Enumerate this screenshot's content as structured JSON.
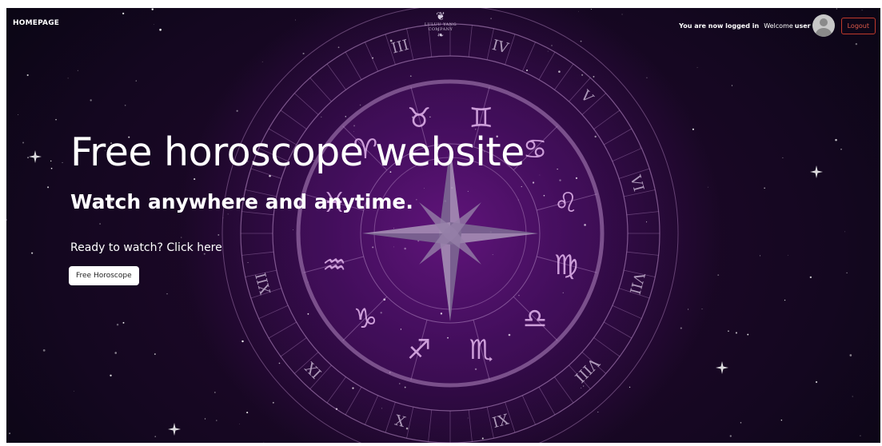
{
  "nav": {
    "home_label": "HOMEPAGE"
  },
  "logo": {
    "brand_line1": "LULUU YANG",
    "brand_line2": "COMPANY",
    "icon": "ornament-icon"
  },
  "user": {
    "status": "You are now logged in",
    "welcome": "Welcome",
    "name": "user",
    "logout_label": "Logout",
    "avatar_icon": "user-avatar-icon"
  },
  "hero": {
    "title": "Free horoscope website",
    "subtitle": "Watch anywhere and anytime.",
    "cta_text": "Ready to watch? Click here",
    "button_label": "Free Horoscope"
  },
  "zodiac": {
    "numerals": [
      "III",
      "IV",
      "V",
      "VI",
      "VII",
      "VIII",
      "IX",
      "X",
      "XI",
      "XII"
    ],
    "signs": [
      "♊",
      "♋",
      "♌",
      "♍",
      "♎",
      "♏",
      "♐",
      "♑",
      "♒",
      "♓",
      "♈",
      "♉"
    ]
  },
  "colors": {
    "background": "#140720",
    "glow": "#5c1276",
    "logout": "#c0392b",
    "wheel_line": "#b58ac4"
  }
}
